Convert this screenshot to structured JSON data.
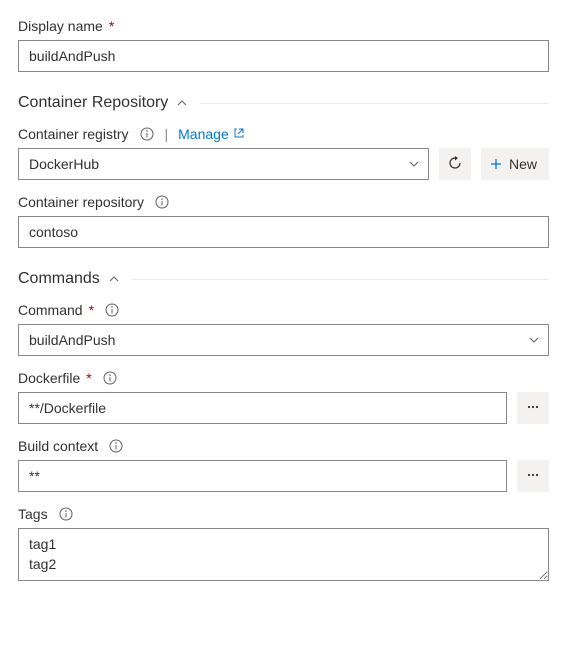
{
  "displayName": {
    "label": "Display name",
    "value": "buildAndPush"
  },
  "sections": {
    "containerRepository": "Container Repository",
    "commands": "Commands"
  },
  "containerRegistry": {
    "label": "Container registry",
    "manage": "Manage",
    "value": "DockerHub",
    "newLabel": "New"
  },
  "containerRepository": {
    "label": "Container repository",
    "value": "contoso"
  },
  "command": {
    "label": "Command",
    "value": "buildAndPush"
  },
  "dockerfile": {
    "label": "Dockerfile",
    "value": "**/Dockerfile"
  },
  "buildContext": {
    "label": "Build context",
    "value": "**"
  },
  "tags": {
    "label": "Tags",
    "value": "tag1\ntag2"
  }
}
